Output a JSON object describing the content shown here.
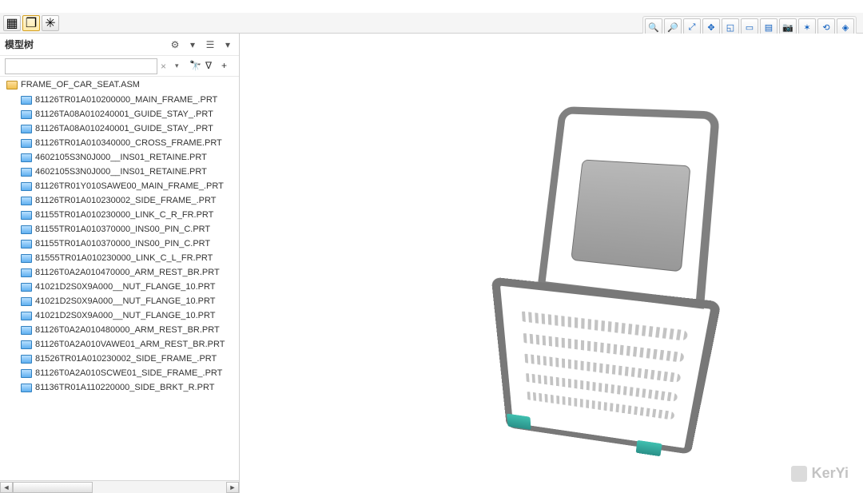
{
  "tabstrip": {
    "icons": [
      "layers",
      "copy",
      "new"
    ]
  },
  "view_toolbar": {
    "icons": [
      "zoom-in",
      "zoom-out",
      "zoom-fit",
      "pan",
      "refit",
      "box",
      "page",
      "camera",
      "tools",
      "orient",
      "display"
    ]
  },
  "sidebar": {
    "title": "模型树",
    "header_tools": [
      "settings",
      "list",
      "options"
    ],
    "search": {
      "placeholder": ""
    },
    "search_tools": [
      "binoculars",
      "filter",
      "plus"
    ]
  },
  "tree": {
    "root": "FRAME_OF_CAR_SEAT.ASM",
    "items": [
      "81126TR01A010200000_MAIN_FRAME_.PRT",
      "81126TA08A010240001_GUIDE_STAY_.PRT",
      "81126TA08A010240001_GUIDE_STAY_.PRT",
      "81126TR01A010340000_CROSS_FRAME.PRT",
      "4602105S3N0J000__INS01_RETAINE.PRT",
      "4602105S3N0J000__INS01_RETAINE.PRT",
      "81126TR01Y010SAWE00_MAIN_FRAME_.PRT",
      "81126TR01A010230002_SIDE_FRAME_.PRT",
      "81155TR01A010230000_LINK_C_R_FR.PRT",
      "81155TR01A010370000_INS00_PIN_C.PRT",
      "81155TR01A010370000_INS00_PIN_C.PRT",
      "81555TR01A010230000_LINK_C_L_FR.PRT",
      "81126T0A2A010470000_ARM_REST_BR.PRT",
      "41021D2S0X9A000__NUT_FLANGE_10.PRT",
      "41021D2S0X9A000__NUT_FLANGE_10.PRT",
      "41021D2S0X9A000__NUT_FLANGE_10.PRT",
      "81126T0A2A010480000_ARM_REST_BR.PRT",
      "81126T0A2A010VAWE01_ARM_REST_BR.PRT",
      "81526TR01A010230002_SIDE_FRAME_.PRT",
      "81126T0A2A010SCWE01_SIDE_FRAME_.PRT",
      "81136TR01A110220000_SIDE_BRKT_R.PRT"
    ]
  },
  "watermark": "KerYi"
}
